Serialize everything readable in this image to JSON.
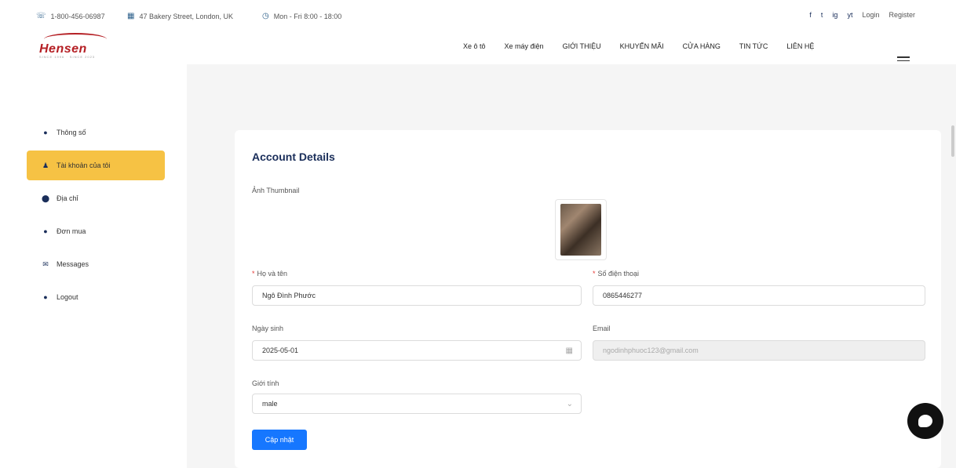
{
  "topbar": {
    "phone": "1-800-456-06987",
    "address": "47 Bakery Street, London, UK",
    "hours": "Mon - Fri 8:00 - 18:00",
    "social": [
      "f",
      "t",
      "ig",
      "yt"
    ],
    "login": "Login",
    "register": "Register"
  },
  "nav": {
    "logo": "Hensen",
    "logo_sub": "SINCE 1996 · SINCE 2023",
    "items": [
      "Xe ô tô",
      "Xe máy điện",
      "GIỚI THIỆU",
      "KHUYẾN MÃI",
      "CỬA HÀNG",
      "TIN TỨC",
      "LIÊN HỆ"
    ]
  },
  "sidebar": {
    "items": [
      {
        "label": "Thông số",
        "icon": "dashboard-icon",
        "glyph": "●"
      },
      {
        "label": "Tài khoản của tôi",
        "icon": "user-icon",
        "glyph": "♟"
      },
      {
        "label": "Địa chỉ",
        "icon": "location-pin-icon",
        "glyph": "⬤"
      },
      {
        "label": "Đơn mua",
        "icon": "order-icon",
        "glyph": "●"
      },
      {
        "label": "Messages",
        "icon": "mail-icon",
        "glyph": "✉"
      },
      {
        "label": "Logout",
        "icon": "logout-icon",
        "glyph": "●"
      }
    ],
    "active_index": 1
  },
  "account": {
    "title": "Account Details",
    "thumbnail_label": "Ảnh Thumbnail",
    "full_name_label": "Họ và tên",
    "full_name_value": "Ngô Đình Phước",
    "phone_label": "Số điện thoại",
    "phone_value": "0865446277",
    "dob_label": "Ngày sinh",
    "dob_value": "2025-05-01",
    "email_label": "Email",
    "email_value": "ngodinhphuoc123@gmail.com",
    "gender_label": "Giới tính",
    "gender_value": "male",
    "update_button": "Cập nhật"
  },
  "colors": {
    "active_sidebar": "#f6c244",
    "primary_button": "#1677ff",
    "heading": "#1a2e5a"
  }
}
